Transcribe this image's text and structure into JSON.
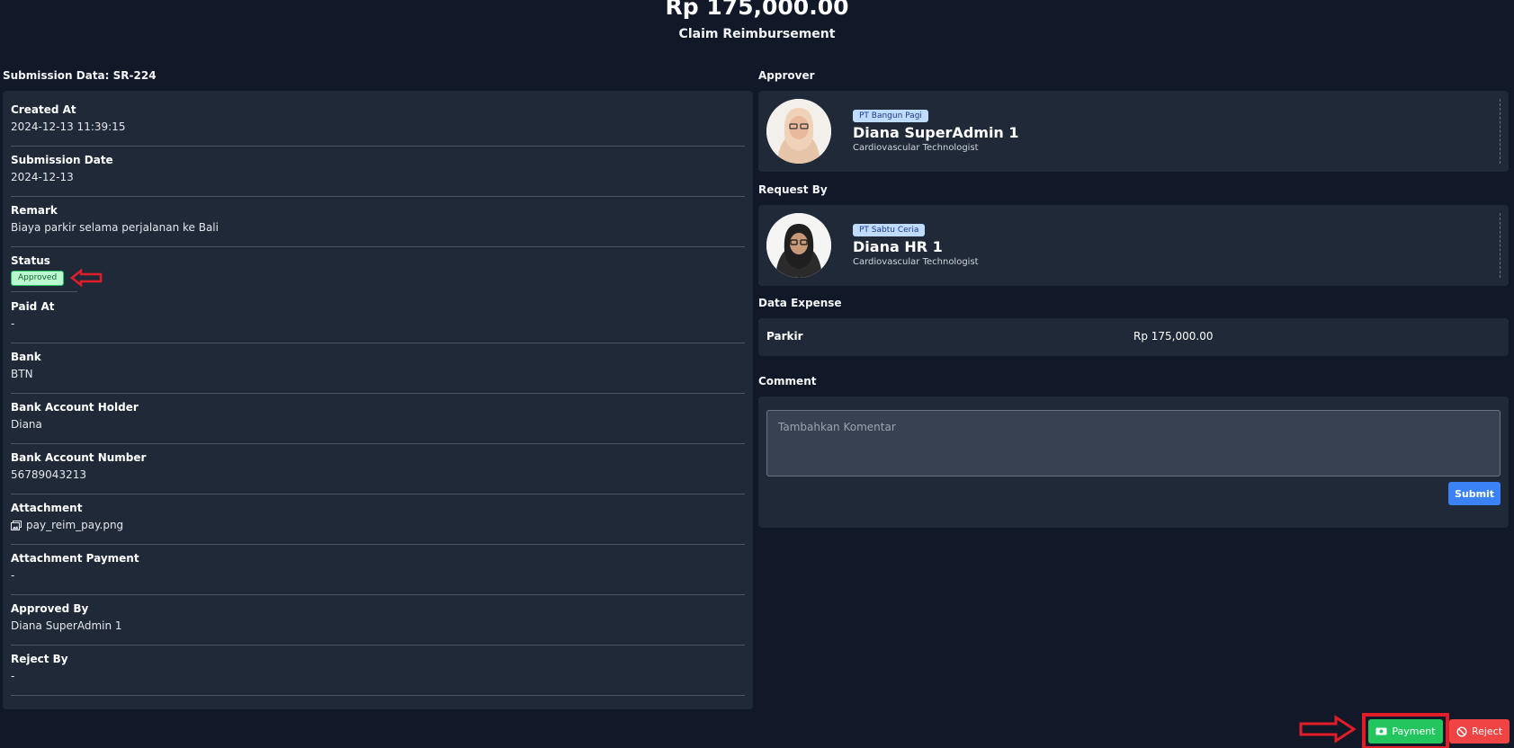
{
  "header": {
    "amount": "Rp 175,000.00",
    "title": "Claim Reimbursement"
  },
  "submission": {
    "title": "Submission Data: SR-224",
    "fields": [
      {
        "label": "Created At",
        "value": "2024-12-13 11:39:15"
      },
      {
        "label": "Submission Date",
        "value": "2024-12-13"
      },
      {
        "label": "Remark",
        "value": "Biaya parkir selama perjalanan ke Bali"
      },
      {
        "label": "Status",
        "value": "Approved"
      },
      {
        "label": "Paid At",
        "value": "-"
      },
      {
        "label": "Bank",
        "value": "BTN"
      },
      {
        "label": "Bank Account Holder",
        "value": "Diana"
      },
      {
        "label": "Bank Account Number",
        "value": "56789043213"
      },
      {
        "label": "Attachment",
        "value": "pay_reim_pay.png"
      },
      {
        "label": "Attachment Payment",
        "value": "-"
      },
      {
        "label": "Approved By",
        "value": "Diana SuperAdmin 1"
      },
      {
        "label": "Reject By",
        "value": "-"
      }
    ]
  },
  "approver": {
    "section_title": "Approver",
    "company": "PT Bangun Pagi",
    "name": "Diana SuperAdmin 1",
    "role": "Cardiovascular Technologist"
  },
  "request_by": {
    "section_title": "Request By",
    "company": "PT Sabtu Ceria",
    "name": "Diana HR 1",
    "role": "Cardiovascular Technologist"
  },
  "expense": {
    "section_title": "Data Expense",
    "items": [
      {
        "name": "Parkir",
        "amount": "Rp 175,000.00"
      }
    ]
  },
  "comment": {
    "section_title": "Comment",
    "placeholder": "Tambahkan Komentar",
    "submit_label": "Submit"
  },
  "actions": {
    "payment_label": "Payment",
    "reject_label": "Reject"
  },
  "colors": {
    "background": "#111827",
    "card": "#1f2937",
    "approved": "#22c55e",
    "reject": "#ef4444",
    "submit": "#3b82f6",
    "annotation": "#e11d2a"
  },
  "icons": {
    "attachment": "image-icon",
    "payment": "money-icon",
    "reject": "ban-icon",
    "annotation": "arrow-left-icon"
  }
}
